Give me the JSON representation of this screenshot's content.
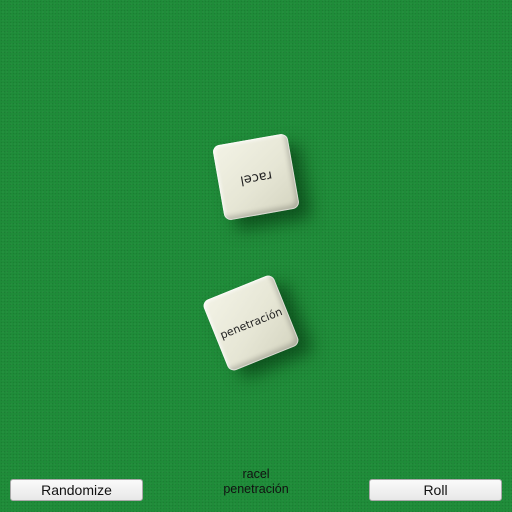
{
  "dice": [
    {
      "face": "racel"
    },
    {
      "face": "penetración"
    }
  ],
  "controls": {
    "randomize_label": "Randomize",
    "roll_label": "Roll"
  },
  "results": [
    "racel",
    "penetración"
  ],
  "colors": {
    "table_felt": "#1f8c39",
    "die_face": "#ecece0"
  }
}
